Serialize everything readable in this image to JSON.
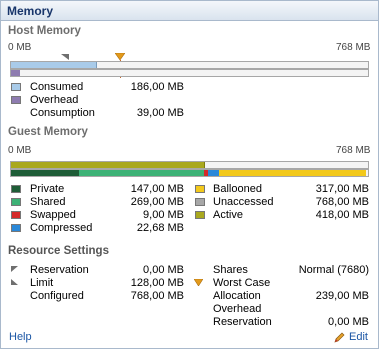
{
  "panel": {
    "title": "Memory"
  },
  "host": {
    "title": "Host Memory",
    "axis_min": "0 MB",
    "axis_max": "768 MB",
    "total_mb": 768,
    "consumed_mb": 186,
    "overhead_mb": 39,
    "items": [
      {
        "label": "Consumed",
        "value": "186,00 MB",
        "color": "#a9cbe9"
      },
      {
        "label": "Overhead",
        "value": "",
        "color": "#8e7cb0"
      },
      {
        "label": "Consumption",
        "value": "39,00 MB",
        "color": ""
      }
    ]
  },
  "guest": {
    "title": "Guest Memory",
    "axis_min": "0 MB",
    "axis_max": "768 MB",
    "total_mb": 768,
    "active_mb": 418,
    "private_mb": 147,
    "shared_mb": 269,
    "swapped_mb": 9,
    "compressed_mb": 22.68,
    "ballooned_mb": 317,
    "left_items": [
      {
        "label": "Private",
        "value": "147,00 MB",
        "color": "#1e5d37"
      },
      {
        "label": "Shared",
        "value": "269,00 MB",
        "color": "#3db276"
      },
      {
        "label": "Swapped",
        "value": "9,00 MB",
        "color": "#d42a2a"
      },
      {
        "label": "Compressed",
        "value": "22,68 MB",
        "color": "#2a88d8"
      }
    ],
    "right_items": [
      {
        "label": "Ballooned",
        "value": "317,00 MB",
        "color": "#f3c91b"
      },
      {
        "label": "Unaccessed",
        "value": "768,00 MB",
        "color": "#a7a7a7"
      },
      {
        "label": "Active",
        "value": "418,00 MB",
        "color": "#a9a81e"
      }
    ]
  },
  "resource": {
    "title": "Resource Settings",
    "reservation": {
      "label": "Reservation",
      "value": "0,00 MB"
    },
    "limit": {
      "label": "Limit",
      "value": "128,00 MB"
    },
    "configured": {
      "label": "Configured",
      "value": "768,00 MB"
    },
    "shares": {
      "label": "Shares",
      "value": "Normal (7680)"
    },
    "worst_case": {
      "label": "Worst Case",
      "value": ""
    },
    "allocation": {
      "label": "Allocation",
      "value": "239,00 MB"
    },
    "overhead": {
      "label": "Overhead",
      "value": ""
    },
    "overhead_reservation": {
      "label": "Reservation",
      "value": "0,00 MB"
    }
  },
  "footer": {
    "help": "Help",
    "edit": "Edit"
  },
  "colors": {
    "marker_orange": "#e39a1b",
    "marker_gray": "#6f6f6f",
    "line_orange": "#c86a2a"
  }
}
